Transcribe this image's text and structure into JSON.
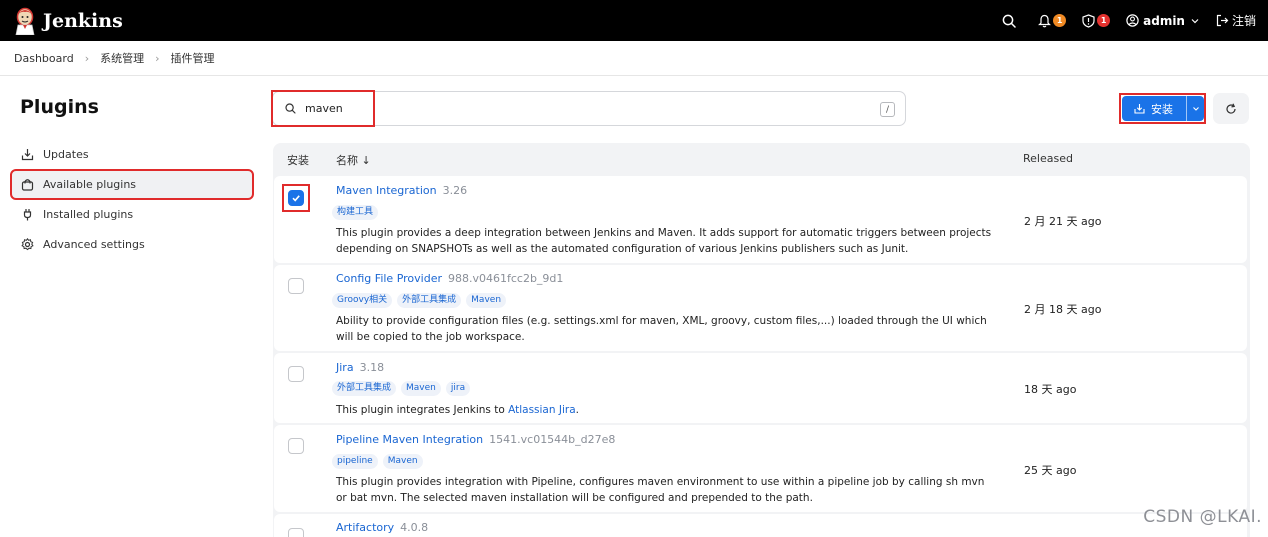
{
  "header": {
    "app_title": "Jenkins",
    "notifications_count": "1",
    "security_count": "1",
    "user_name": "admin",
    "logout_label": "注销"
  },
  "breadcrumb": [
    "Dashboard",
    "系统管理",
    "插件管理"
  ],
  "sidebar": {
    "title": "Plugins",
    "items": [
      {
        "label": "Updates",
        "icon": "download-icon"
      },
      {
        "label": "Available plugins",
        "icon": "shopping-bag-icon",
        "active": true
      },
      {
        "label": "Installed plugins",
        "icon": "plug-icon"
      },
      {
        "label": "Advanced settings",
        "icon": "gear-icon"
      }
    ]
  },
  "search": {
    "value": "maven",
    "shortcut": "/"
  },
  "toolbar": {
    "install_label": "安装"
  },
  "table": {
    "headers": {
      "install": "安装",
      "name": "名称 ↓",
      "released": "Released"
    },
    "rows": [
      {
        "name": "Maven Integration",
        "version": "3.26",
        "tags": [
          "构建工具"
        ],
        "description": "This plugin provides a deep integration between Jenkins and Maven. It adds support for automatic triggers between projects depending on SNAPSHOTs as well as the automated configuration of various Jenkins publishers such as Junit.",
        "released": "2 月 21 天 ago",
        "checked": true
      },
      {
        "name": "Config File Provider",
        "version": "988.v0461fcc2b_9d1",
        "tags": [
          "Groovy相关",
          "外部工具集成",
          "Maven"
        ],
        "description": "Ability to provide configuration files (e.g. settings.xml for maven, XML, groovy, custom files,...) loaded through the UI which will be copied to the job workspace.",
        "released": "2 月 18 天 ago",
        "checked": false
      },
      {
        "name": "Jira",
        "version": "3.18",
        "tags": [
          "外部工具集成",
          "Maven",
          "jira"
        ],
        "description_prefix": "This plugin integrates Jenkins to ",
        "description_link": "Atlassian Jira",
        "description_suffix": ".",
        "released": "18 天 ago",
        "checked": false
      },
      {
        "name": "Pipeline Maven Integration",
        "version": "1541.vc01544b_d27e8",
        "tags": [
          "pipeline",
          "Maven"
        ],
        "description": "This plugin provides integration with Pipeline, configures maven environment to use within a pipeline job by calling sh mvn or bat mvn. The selected maven installation will be configured and prepended to the path.",
        "released": "25 天 ago",
        "checked": false
      },
      {
        "name": "Artifactory",
        "version": "4.0.8",
        "checked": false
      }
    ]
  },
  "watermark": "CSDN @LKAI."
}
